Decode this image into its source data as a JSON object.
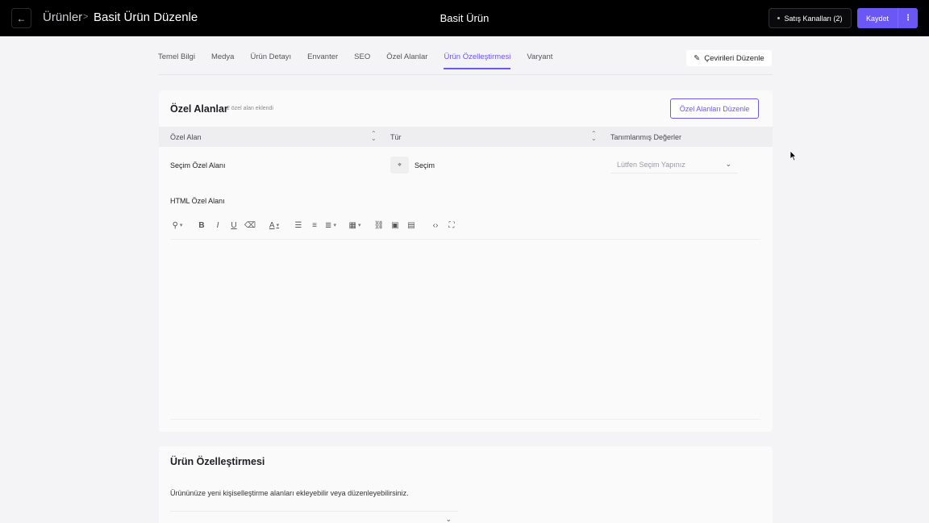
{
  "header": {
    "back_icon": "arrow-left-icon",
    "breadcrumb_parent": "Ürünler",
    "breadcrumb_separator": ">",
    "breadcrumb_current": "Basit Ürün Düzenle",
    "center_title": "Basit Ürün",
    "sales_channels_label": "Satış Kanalları (2)",
    "save_label": "Kaydet",
    "more_icon": "vertical-dots-icon",
    "accent_color": "#6b57f5"
  },
  "tabs": [
    {
      "label": "Temel Bilgi",
      "active": false
    },
    {
      "label": "Medya",
      "active": false
    },
    {
      "label": "Ürün Detayı",
      "active": false
    },
    {
      "label": "Envanter",
      "active": false
    },
    {
      "label": "SEO",
      "active": false
    },
    {
      "label": "Özel Alanlar",
      "active": false
    },
    {
      "label": "Ürün Özelleştirmesi",
      "active": true
    },
    {
      "label": "Varyant",
      "active": false
    }
  ],
  "translations_button": "Çevirileri Düzenle",
  "custom_fields": {
    "title": "Özel Alanlar",
    "subtitle": "2 özel alan eklendi",
    "edit_button": "Özel Alanları Düzenle",
    "columns": [
      "Özel Alan",
      "Tür",
      "Tanımlanmış Değerler"
    ],
    "rows": [
      {
        "field": "Seçim Özel Alanı",
        "type": "Seçim",
        "value_placeholder": "Lütfen Seçim Yapınız"
      },
      {
        "field": "HTML Özel Alanı"
      }
    ]
  },
  "customization": {
    "title": "Ürün Özelleştirmesi",
    "description": "Ürününüze yeni kişiselleştirme alanları ekleyebilir veya düzenleyebilirsiniz."
  }
}
